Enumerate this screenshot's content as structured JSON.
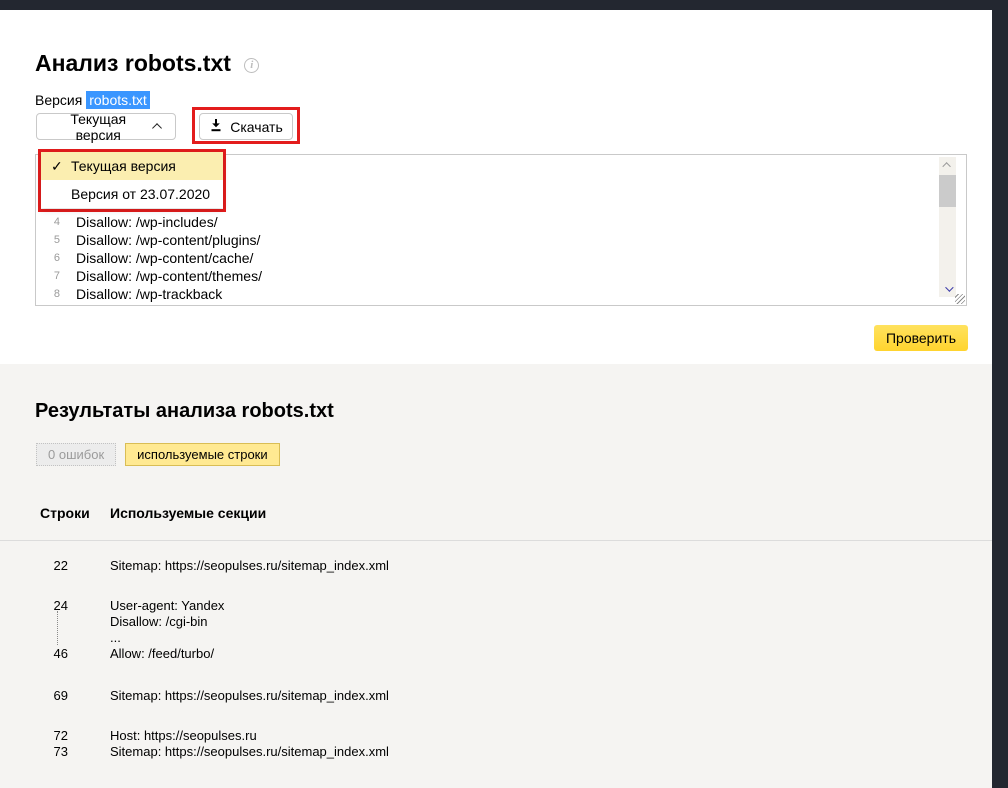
{
  "analysis": {
    "title": "Анализ robots.txt",
    "version_label": "Версия",
    "version_value": "robots.txt",
    "version_select_label": "Текущая версия",
    "download_label": "Скачать",
    "menu_items": [
      {
        "label": "Текущая версия",
        "selected": true,
        "check": "✓"
      },
      {
        "label": "Версия от 23.07.2020",
        "selected": false,
        "check": "✓"
      }
    ],
    "editor_lines": [
      {
        "num": "4",
        "text": "Disallow: /wp-includes/"
      },
      {
        "num": "5",
        "text": "Disallow: /wp-content/plugins/"
      },
      {
        "num": "6",
        "text": "Disallow: /wp-content/cache/"
      },
      {
        "num": "7",
        "text": "Disallow: /wp-content/themes/"
      },
      {
        "num": "8",
        "text": "Disallow: /wp-trackback"
      }
    ],
    "check_button_label": "Проверить"
  },
  "results": {
    "title": "Результаты анализа robots.txt",
    "tabs": [
      {
        "label": "0 ошибок",
        "selected": false
      },
      {
        "label": "используемые строки",
        "selected": true
      }
    ],
    "table": {
      "headers": {
        "lines": "Строки",
        "sections": "Используемые секции"
      },
      "rows": [
        {
          "entries": [
            {
              "num": "22",
              "text": "Sitemap: https://seopulses.ru/sitemap_index.xml"
            }
          ]
        },
        {
          "entries": [
            {
              "num": "24",
              "text": "User-agent: Yandex"
            },
            {
              "num": "",
              "text": "Disallow: /cgi-bin"
            },
            {
              "num": "",
              "text": "..."
            },
            {
              "num": "46",
              "text": "Allow: /feed/turbo/"
            }
          ]
        },
        {
          "entries": [
            {
              "num": "69",
              "text": "Sitemap: https://seopulses.ru/sitemap_index.xml"
            }
          ]
        },
        {
          "entries": [
            {
              "num": "72",
              "text": "Host: https://seopulses.ru"
            },
            {
              "num": "73",
              "text": "Sitemap: https://seopulses.ru/sitemap_index.xml"
            }
          ]
        }
      ]
    }
  },
  "colors": {
    "accent_yellow": "#ffd42e",
    "menu_selected_yellow": "#fbeeb0",
    "tab_selected_yellow": "#ffe992",
    "annotation_red": "#e31c1c",
    "selection_blue": "#3a96ff",
    "chrome_dark": "#232730",
    "results_background": "#f5f4f2"
  }
}
